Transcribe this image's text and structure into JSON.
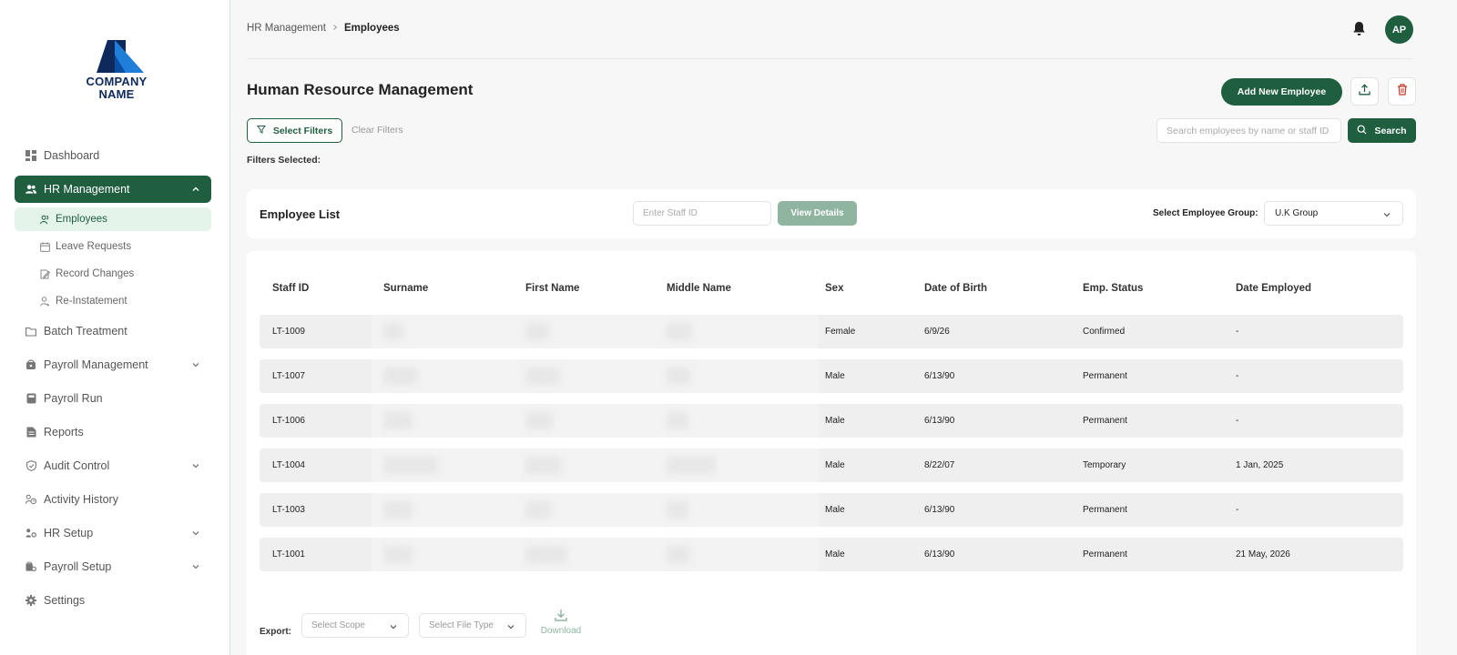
{
  "brand": {
    "logo_line1": "COMPANY",
    "logo_line2": "NAME"
  },
  "sidebar": {
    "items": [
      {
        "label": "Dashboard",
        "icon": "dashboard-icon"
      },
      {
        "label": "HR Management",
        "icon": "users-icon",
        "active": true,
        "expanded": true,
        "children": [
          {
            "label": "Employees",
            "icon": "user-icon",
            "active": true
          },
          {
            "label": "Leave Requests",
            "icon": "calendar-icon"
          },
          {
            "label": "Record Changes",
            "icon": "edit-icon"
          },
          {
            "label": "Re-Instatement",
            "icon": "user-restore-icon"
          }
        ]
      },
      {
        "label": "Batch Treatment",
        "icon": "folder-icon"
      },
      {
        "label": "Payroll Management",
        "icon": "wallet-icon",
        "expandable": true
      },
      {
        "label": "Payroll Run",
        "icon": "calculator-icon"
      },
      {
        "label": "Reports",
        "icon": "report-icon"
      },
      {
        "label": "Audit Control",
        "icon": "shield-icon",
        "expandable": true
      },
      {
        "label": "Activity History",
        "icon": "history-icon"
      },
      {
        "label": "HR Setup",
        "icon": "hr-setup-icon",
        "expandable": true
      },
      {
        "label": "Payroll Setup",
        "icon": "payroll-setup-icon",
        "expandable": true
      },
      {
        "label": "Settings",
        "icon": "gear-icon"
      }
    ]
  },
  "header": {
    "breadcrumb": [
      "HR Management",
      "Employees"
    ],
    "avatar_initials": "AP"
  },
  "page": {
    "title": "Human Resource Management",
    "add_button": "Add New Employee",
    "select_filters": "Select Filters",
    "clear_filters": "Clear Filters",
    "filters_selected": "Filters Selected:",
    "search_placeholder": "Search employees by name or staff ID",
    "search_button": "Search"
  },
  "employee_list": {
    "title": "Employee List",
    "staff_id_placeholder": "Enter Staff ID",
    "view_details": "View Details",
    "group_label": "Select Employee Group:",
    "group_value": "U.K Group"
  },
  "table": {
    "columns": [
      "Staff ID",
      "Surname",
      "First Name",
      "Middle Name",
      "Sex",
      "Date of Birth",
      "Emp. Status",
      "Date Employed"
    ],
    "rows": [
      {
        "staff_id": "LT-1009",
        "sex": "Female",
        "dob": "6/9/26",
        "status": "Confirmed",
        "employed": "-"
      },
      {
        "staff_id": "LT-1007",
        "sex": "Male",
        "dob": "6/13/90",
        "status": "Permanent",
        "employed": "-"
      },
      {
        "staff_id": "LT-1006",
        "sex": "Male",
        "dob": "6/13/90",
        "status": "Permanent",
        "employed": "-"
      },
      {
        "staff_id": "LT-1004",
        "sex": "Male",
        "dob": "8/22/07",
        "status": "Temporary",
        "employed": "1 Jan, 2025"
      },
      {
        "staff_id": "LT-1003",
        "sex": "Male",
        "dob": "6/13/90",
        "status": "Permanent",
        "employed": "-"
      },
      {
        "staff_id": "LT-1001",
        "sex": "Male",
        "dob": "6/13/90",
        "status": "Permanent",
        "employed": "21 May, 2026"
      }
    ]
  },
  "export": {
    "label": "Export:",
    "scope_placeholder": "Select Scope",
    "file_type_placeholder": "Select File Type",
    "download": "Download"
  },
  "colors": {
    "primary": "#1f5e3f",
    "primary_light": "#e4f4ea",
    "muted_green": "#8fb5a1",
    "danger": "#c0392b"
  }
}
